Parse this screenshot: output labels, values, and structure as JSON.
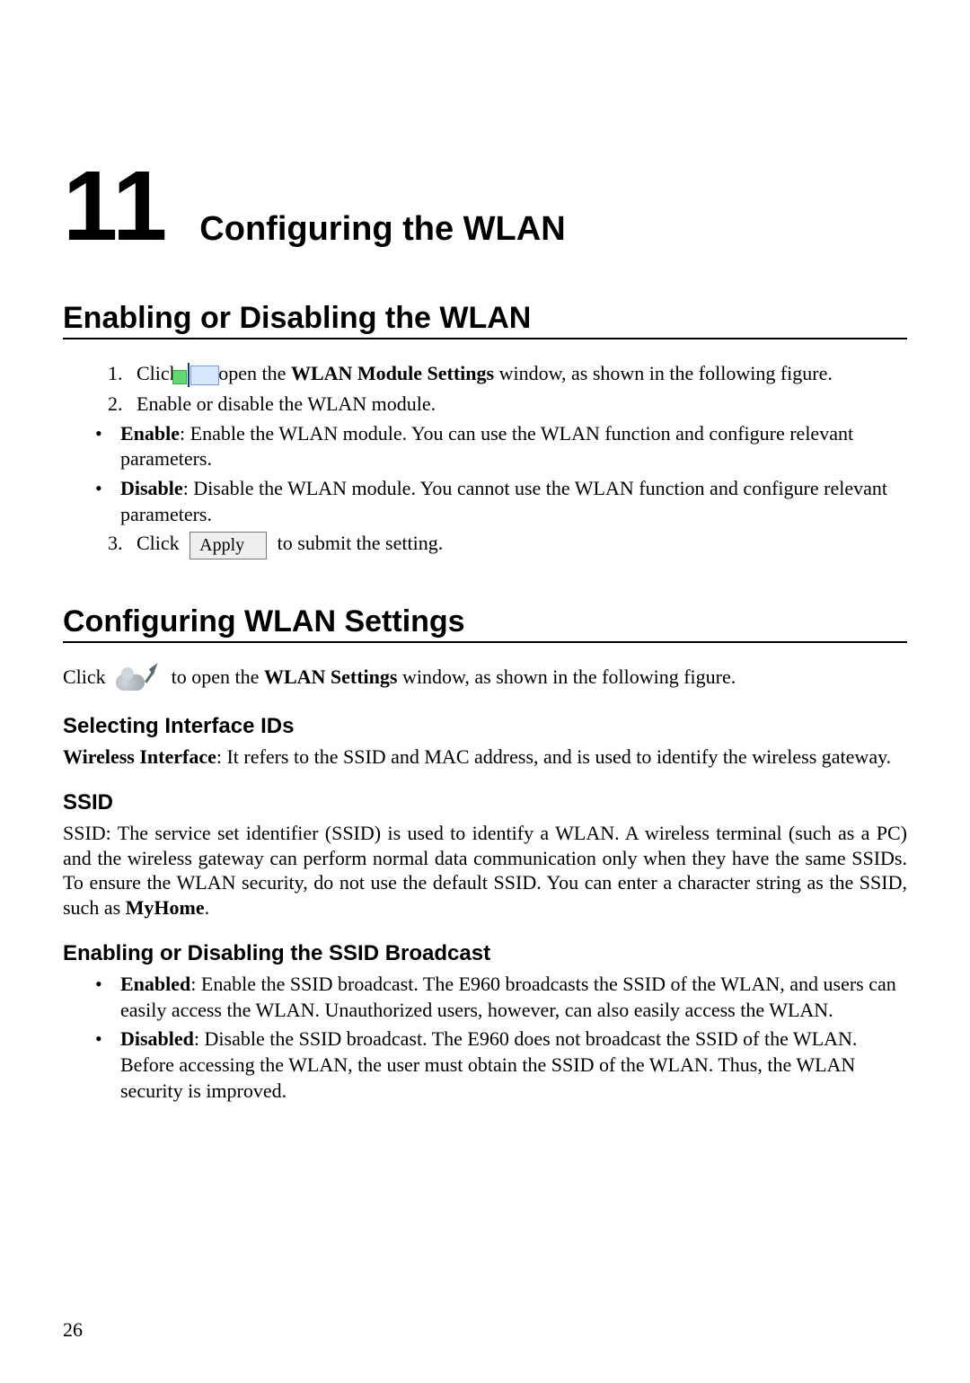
{
  "chapter": {
    "number": "11",
    "title": "Configuring the WLAN"
  },
  "section1": {
    "heading": "Enabling or Disabling the WLAN",
    "step1_a": "Click",
    "step1_b": " to open the ",
    "step1_bold": "WLAN Module Settings",
    "step1_c": " window, as shown in the following figure.",
    "step2": "Enable or disable the WLAN module.",
    "bullet1_bold": "Enable",
    "bullet1_rest": ": Enable the WLAN module. You can use the WLAN function and configure relevant parameters.",
    "bullet2_bold": "Disable",
    "bullet2_rest": ": Disable the WLAN module. You cannot use the WLAN function and configure relevant parameters.",
    "step3_a": "Click",
    "apply_label": "Apply",
    "step3_b": " to submit the setting."
  },
  "section2": {
    "heading": "Configuring WLAN Settings",
    "intro_a": "Click",
    "intro_b": " to open the ",
    "intro_bold": "WLAN Settings",
    "intro_c": " window, as shown in the following figure.",
    "sub1_heading": "Selecting Interface IDs",
    "sub1_bold": "Wireless Interface",
    "sub1_rest": ": It refers to the SSID and MAC address, and is used to identify the wireless gateway.",
    "sub2_heading": "SSID",
    "sub2_p_a": "SSID: The service set identifier (SSID) is used to identify a WLAN. A wireless terminal (such as a PC) and the wireless gateway can perform normal data communication only when they have the same SSIDs. To ensure the WLAN security, do not use the default SSID. You can enter a character string as the SSID, such as ",
    "sub2_p_bold": "MyHome",
    "sub2_p_b": ".",
    "sub3_heading": "Enabling or Disabling the SSID Broadcast",
    "sub3_b1_bold": "Enabled",
    "sub3_b1_rest": ": Enable the SSID broadcast. The E960 broadcasts the SSID of the WLAN, and users can easily access the WLAN. Unauthorized users, however, can also easily access the WLAN.",
    "sub3_b2_bold": "Disabled",
    "sub3_b2_rest": ": Disable the SSID broadcast. The E960 does not broadcast the SSID of the WLAN. Before accessing the WLAN, the user must obtain the SSID of the WLAN. Thus, the WLAN security is improved."
  },
  "page_number": "26"
}
